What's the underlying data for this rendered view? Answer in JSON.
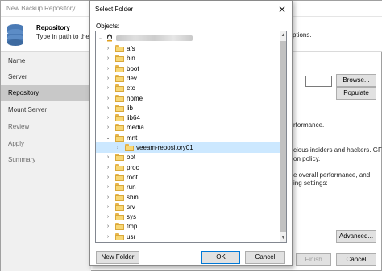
{
  "background": {
    "title": "New Backup Repository",
    "heading": "Repository",
    "subheading": "Type in path to the f",
    "subheading_tail": "ptions.",
    "sidebar": [
      {
        "label": "Name"
      },
      {
        "label": "Server"
      },
      {
        "label": "Repository",
        "active": true
      },
      {
        "label": "Mount Server"
      },
      {
        "label": "Review"
      },
      {
        "label": "Apply"
      },
      {
        "label": "Summary"
      }
    ],
    "browse_label": "Browse...",
    "populate_label": "Populate",
    "advanced_label": "Advanced...",
    "finish_label": "Finish",
    "cancel_label": "Cancel",
    "text_performance": "rformance.",
    "text_insiders": "cious insiders and hackers. GFS",
    "text_policy": "on policy.",
    "text_overall": "e overall performance, and",
    "text_settings": "ing settings:"
  },
  "dialog": {
    "title": "Select Folder",
    "close_glyph": "✕",
    "objects_label": "Objects:",
    "tree": [
      {
        "label": "afs",
        "depth": 1,
        "expanded": false
      },
      {
        "label": "bin",
        "depth": 1,
        "expanded": false
      },
      {
        "label": "boot",
        "depth": 1,
        "expanded": false
      },
      {
        "label": "dev",
        "depth": 1,
        "expanded": false
      },
      {
        "label": "etc",
        "depth": 1,
        "expanded": false
      },
      {
        "label": "home",
        "depth": 1,
        "expanded": false
      },
      {
        "label": "lib",
        "depth": 1,
        "expanded": false
      },
      {
        "label": "lib64",
        "depth": 1,
        "expanded": false
      },
      {
        "label": "media",
        "depth": 1,
        "expanded": false
      },
      {
        "label": "mnt",
        "depth": 1,
        "expanded": true
      },
      {
        "label": "veeam-repository01",
        "depth": 2,
        "expanded": false,
        "selected": true
      },
      {
        "label": "opt",
        "depth": 1,
        "expanded": false
      },
      {
        "label": "proc",
        "depth": 1,
        "expanded": false
      },
      {
        "label": "root",
        "depth": 1,
        "expanded": false
      },
      {
        "label": "run",
        "depth": 1,
        "expanded": false
      },
      {
        "label": "sbin",
        "depth": 1,
        "expanded": false
      },
      {
        "label": "srv",
        "depth": 1,
        "expanded": false
      },
      {
        "label": "sys",
        "depth": 1,
        "expanded": false
      },
      {
        "label": "tmp",
        "depth": 1,
        "expanded": false
      },
      {
        "label": "usr",
        "depth": 1,
        "expanded": false
      }
    ],
    "new_folder_label": "New Folder",
    "ok_label": "OK",
    "cancel_label": "Cancel"
  },
  "colors": {
    "selection": "#cce8ff",
    "folder": "#f8d775",
    "accent_border": "#0078d7"
  }
}
